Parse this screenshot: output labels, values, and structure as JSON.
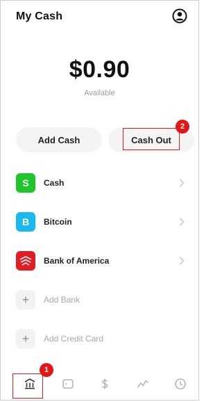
{
  "header": {
    "title": "My Cash",
    "profile_icon": "profile-icon"
  },
  "balance": {
    "amount": "$0.90",
    "subtitle": "Available"
  },
  "actions": {
    "add_cash": "Add Cash",
    "cash_out": "Cash Out"
  },
  "annotations": {
    "marker_cash_out": "2",
    "marker_home": "1"
  },
  "accounts": [
    {
      "label": "Cash",
      "icon": "S",
      "icon_color": "#1ec62b"
    },
    {
      "label": "Bitcoin",
      "icon": "B",
      "icon_color": "#19b9ef"
    },
    {
      "label": "Bank of America",
      "icon": "bank-of-america-logo",
      "icon_color": "#e31c24"
    },
    {
      "label": "Add Bank",
      "icon": "+",
      "icon_color": "#f2f2f2"
    },
    {
      "label": "Add Credit Card",
      "icon": "+",
      "icon_color": "#f2f2f2"
    }
  ],
  "tabbar": {
    "tabs": [
      {
        "icon": "bank-icon"
      },
      {
        "icon": "card-icon"
      },
      {
        "icon": "dollar-icon"
      },
      {
        "icon": "activity-icon"
      },
      {
        "icon": "clock-icon"
      }
    ]
  }
}
